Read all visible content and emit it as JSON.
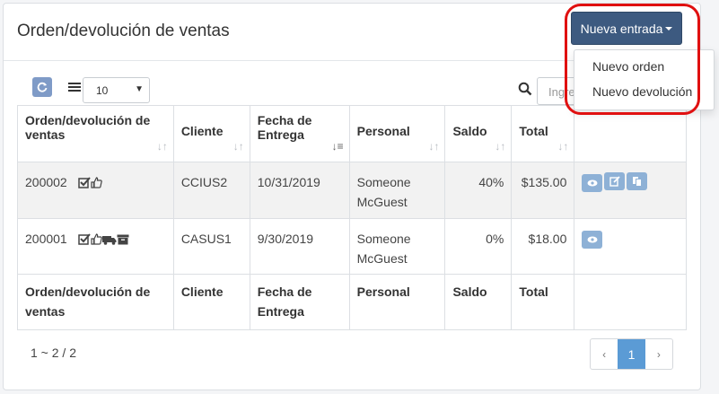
{
  "header": {
    "title": "Orden/devolución de ventas",
    "new_button_label": "Nueva entrada",
    "dropdown": [
      "Nuevo orden",
      "Nuevo devolución"
    ]
  },
  "toolbar": {
    "page_size": "10",
    "search_placeholder": "Ingrese"
  },
  "table": {
    "columns": [
      "Orden/devolución de ventas",
      "Cliente",
      "Fecha de Entrega",
      "Personal",
      "Saldo",
      "Total"
    ],
    "rows": [
      {
        "order": "200002",
        "icons": [
          "check-icon",
          "thumbs-up-icon"
        ],
        "customer": "CCIUS2",
        "date": "10/31/2019",
        "staff": "Someone McGuest",
        "balance": "40%",
        "total": "$135.00",
        "actions": [
          "view-icon",
          "edit-icon",
          "copy-icon"
        ]
      },
      {
        "order": "200001",
        "icons": [
          "check-icon",
          "thumbs-up-icon",
          "truck-icon",
          "archive-icon"
        ],
        "customer": "CASUS1",
        "date": "9/30/2019",
        "staff": "Someone McGuest",
        "balance": "0%",
        "total": "$18.00",
        "actions": [
          "view-icon"
        ]
      }
    ]
  },
  "footer": {
    "range_text": "1 ~ 2 / 2",
    "pages": {
      "prev": "‹",
      "current": "1",
      "next": "›"
    }
  },
  "colors": {
    "primary": "#3d5a80",
    "highlight": "#e01010",
    "action": "#8eb1d6",
    "active_page": "#5b9bd5"
  }
}
